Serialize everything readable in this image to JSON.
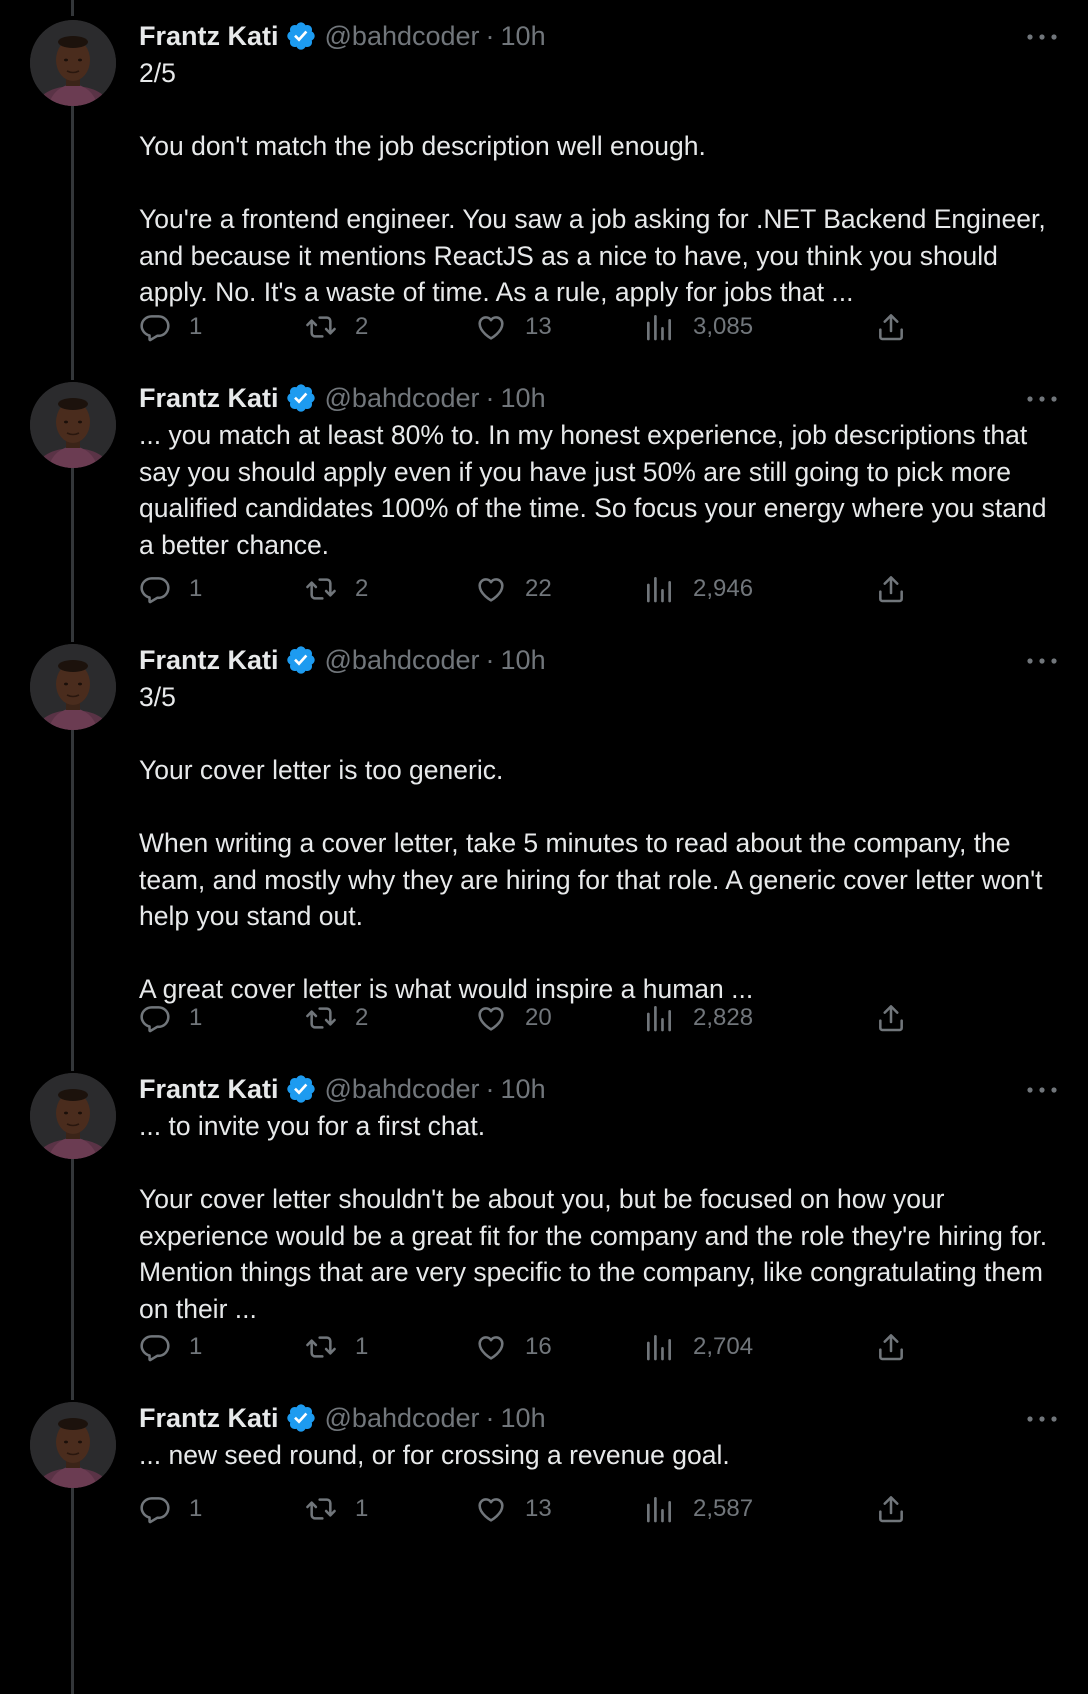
{
  "author": {
    "name": "Frantz Kati",
    "handle": "@bahdcoder",
    "separator": "·",
    "verified": true
  },
  "colors": {
    "background": "#000000",
    "text": "#e7e9ea",
    "muted": "#71767b",
    "verified": "#1d9bf0",
    "thread_line": "#333639"
  },
  "tweets": [
    {
      "time": "10h",
      "text": "2/5\n\nYou don't match the job description well enough.\n\nYou're a frontend engineer. You saw a job asking for .NET Backend Engineer, and because it mentions ReactJS as a nice to have, you think you should apply. No. It's a waste of time. As a rule, apply for jobs that ...",
      "replies": "1",
      "retweets": "2",
      "likes": "13",
      "views": "3,085"
    },
    {
      "time": "10h",
      "text": "... you match at least 80% to. In my honest experience, job descriptions that say you should apply even if you have just 50% are still going to pick more qualified candidates 100% of the time. So focus your energy where you stand a better chance.",
      "replies": "1",
      "retweets": "2",
      "likes": "22",
      "views": "2,946"
    },
    {
      "time": "10h",
      "text": "3/5\n\nYour cover letter is too generic.\n\nWhen writing a cover letter, take 5 minutes to read about the company, the team, and mostly why they are hiring for that role. A generic cover letter won't help you stand out.\n\nA great cover letter is what would inspire a human ...",
      "replies": "1",
      "retweets": "2",
      "likes": "20",
      "views": "2,828"
    },
    {
      "time": "10h",
      "text": "... to invite you for a first chat.\n\nYour cover letter shouldn't be about you, but be focused on how your experience would be a great fit for the company and the role they're hiring for. Mention things that are very specific to the company, like congratulating them on their ...",
      "replies": "1",
      "retweets": "1",
      "likes": "16",
      "views": "2,704"
    },
    {
      "time": "10h",
      "text": "... new seed round, or for crossing a revenue goal.",
      "replies": "1",
      "retweets": "1",
      "likes": "13",
      "views": "2,587"
    }
  ]
}
